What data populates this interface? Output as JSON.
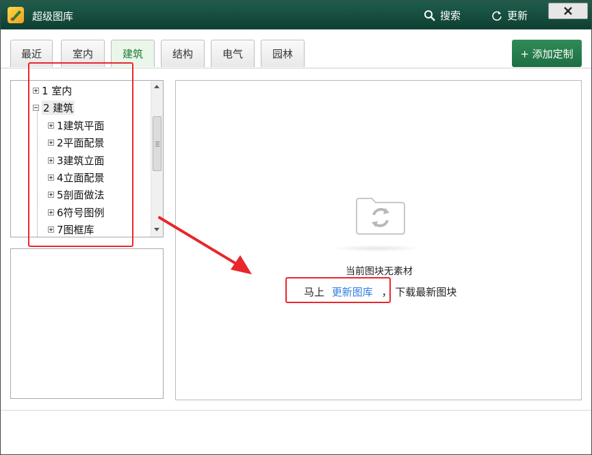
{
  "window": {
    "title": "超级图库",
    "search_label": "搜索",
    "update_label": "更新",
    "close_icon": "close-icon"
  },
  "tabs": [
    {
      "label": "最近",
      "active": false
    },
    {
      "label": "室内",
      "active": false
    },
    {
      "label": "建筑",
      "active": true
    },
    {
      "label": "结构",
      "active": false
    },
    {
      "label": "电气",
      "active": false
    },
    {
      "label": "园林",
      "active": false
    }
  ],
  "add_custom_label": "+ 添加定制",
  "tree": {
    "top_level": [
      {
        "label": "1 室内",
        "state": "collapsed"
      },
      {
        "label": "2 建筑",
        "state": "expanded",
        "selected": true
      }
    ],
    "children": [
      "1建筑平面",
      "2平面配景",
      "3建筑立面",
      "4立面配景",
      "5剖面做法",
      "6符号图例",
      "7图框库"
    ]
  },
  "content": {
    "empty_message": "当前图块无素材",
    "prefix": "马上",
    "link_text": "更新图库",
    "separator": "，",
    "suffix": "下载最新图块"
  },
  "colors": {
    "titlebar": "#0e3f33",
    "accent_green": "#1f6e43",
    "link_blue": "#2f7de1",
    "annotation_red": "#e8262b"
  }
}
